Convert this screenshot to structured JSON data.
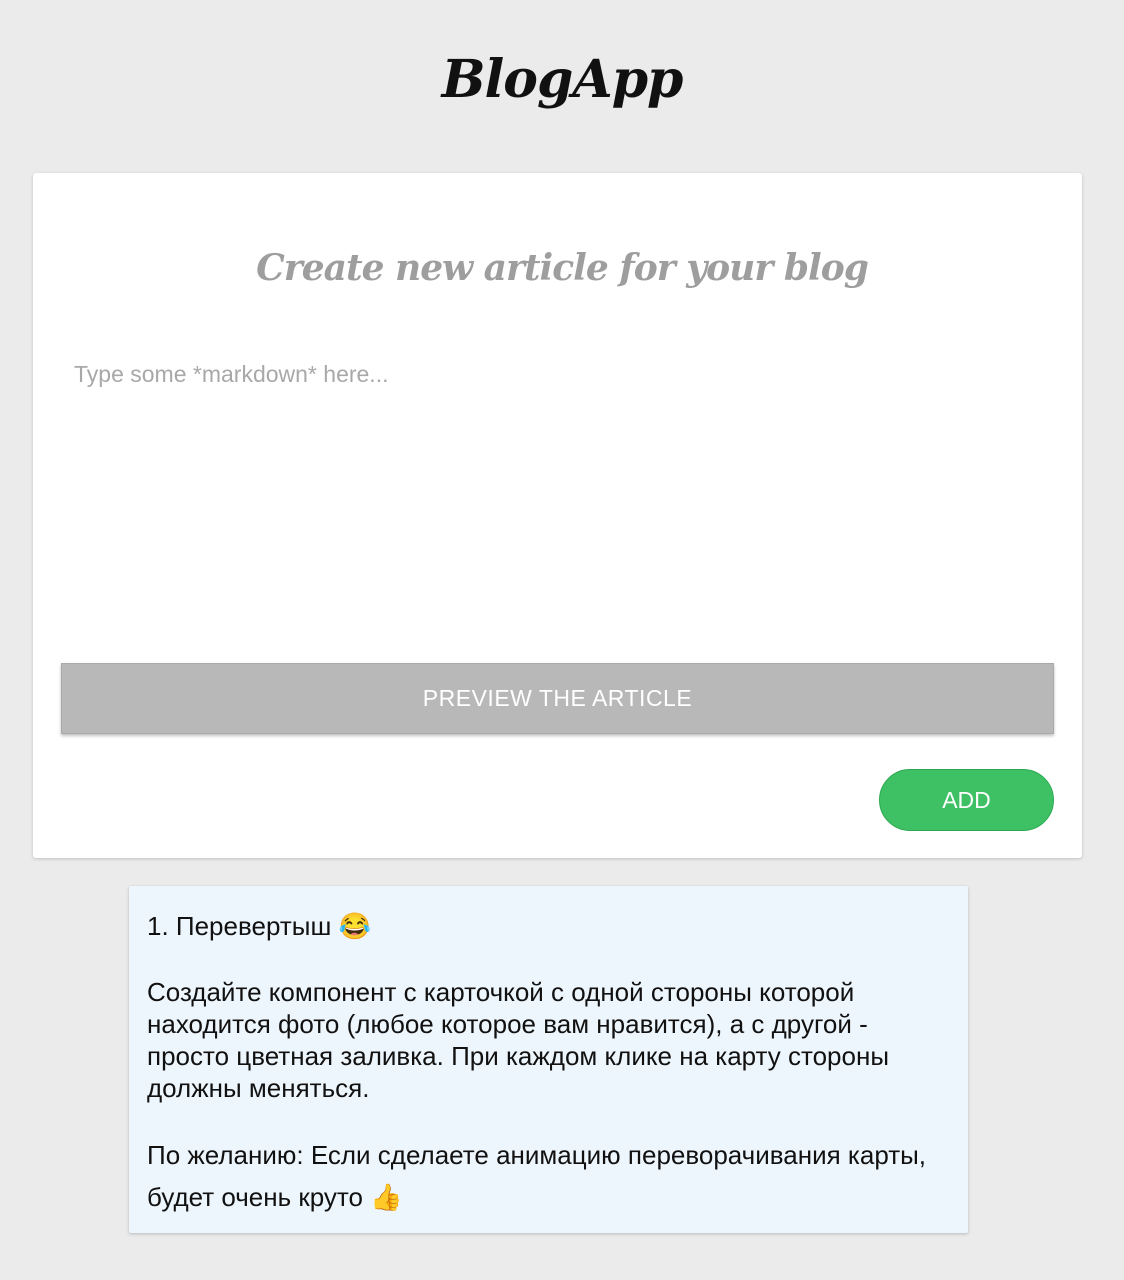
{
  "header": {
    "app_title": "BlogApp"
  },
  "editor": {
    "heading": "Create new article for your blog",
    "placeholder": "Type some *markdown* here...",
    "value": "",
    "preview_label": "PREVIEW THE ARTICLE",
    "add_label": "ADD"
  },
  "task": {
    "title": "1. Перевертыш 😂",
    "body": "Создайте компонент с карточкой с одной стороны которой находится фото (любое которое вам нравится), а с другой - просто цветная заливка. При каждом клике на карту стороны должны меняться.",
    "optional": "По желанию: Если сделаете анимацию переворачивания карты, будет очень круто 👍"
  },
  "colors": {
    "background": "#ebebeb",
    "accent_green": "#3ec164",
    "preview_gray": "#b8b8b8",
    "task_background": "#eef6fd"
  }
}
